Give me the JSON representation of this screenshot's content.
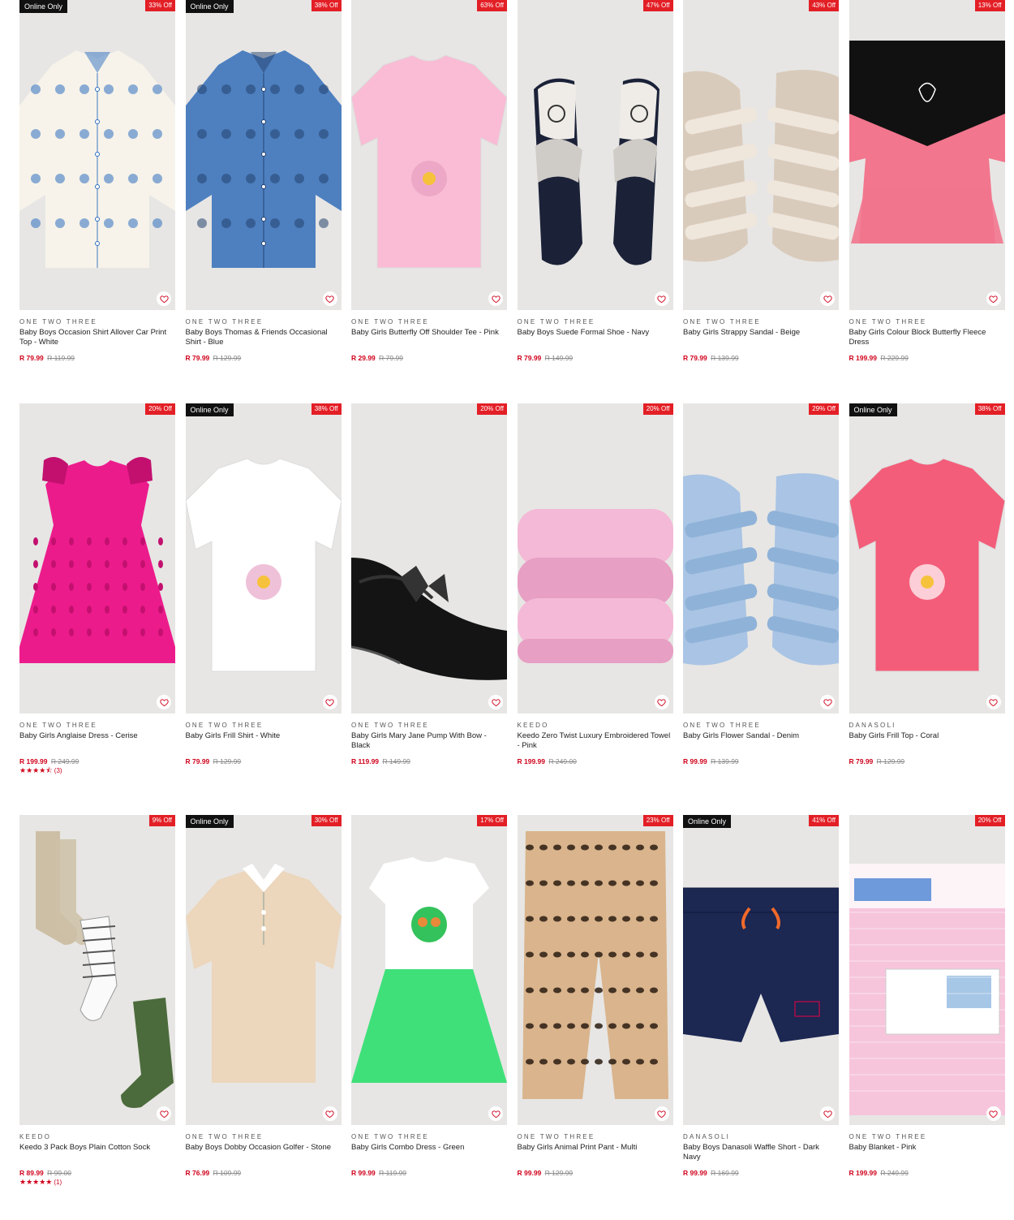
{
  "products": [
    {
      "brand": "ONE TWO THREE",
      "name": "Baby Boys Occasion Shirt Allover Car Print Top - White",
      "price": "R 79.99",
      "was": "R 119.99",
      "discount": "33% Off",
      "online": "Online Only",
      "art": "shirt",
      "color": "#f7f3ea",
      "accent": "#2f6fc0"
    },
    {
      "brand": "ONE TWO THREE",
      "name": "Baby Boys Thomas & Friends Occasional Shirt - Blue",
      "price": "R 79.99",
      "was": "R 129.99",
      "discount": "38% Off",
      "online": "Online Only",
      "art": "shirt",
      "color": "#4e80c0",
      "accent": "#24416e"
    },
    {
      "brand": "ONE TWO THREE",
      "name": "Baby Girls Butterfly Off Shoulder Tee - Pink",
      "price": "R 29.99",
      "was": "R 79.99",
      "discount": "63% Off",
      "online": "",
      "art": "tee",
      "color": "#f9bcd4",
      "accent": "#e7a0c0"
    },
    {
      "brand": "ONE TWO THREE",
      "name": "Baby Boys Suede Formal Shoe - Navy",
      "price": "R 79.99",
      "was": "R 149.99",
      "discount": "47% Off",
      "online": "",
      "art": "shoes",
      "color": "#1b2238",
      "accent": "#cfcbc6"
    },
    {
      "brand": "ONE TWO THREE",
      "name": "Baby Girls Strappy Sandal - Beige",
      "price": "R 79.99",
      "was": "R 139.99",
      "discount": "43% Off",
      "online": "",
      "art": "sandal",
      "color": "#efe6dc",
      "accent": "#d9cbbb"
    },
    {
      "brand": "ONE TWO THREE",
      "name": "Baby Girls Colour Block Butterfly Fleece Dress",
      "price": "R 199.99",
      "was": "R 229.99",
      "discount": "13% Off",
      "online": "",
      "art": "dressblock",
      "color": "#f2768e",
      "accent": "#111111"
    },
    {
      "brand": "ONE TWO THREE",
      "name": "Baby Girls Anglaise Dress - Cerise",
      "price": "R 199.99",
      "was": "R 249.99",
      "discount": "20% Off",
      "online": "",
      "art": "dress",
      "color": "#ec1b8c",
      "accent": "#c3106f",
      "stars": "★★★★⯪",
      "rating_count": "(3)"
    },
    {
      "brand": "ONE TWO THREE",
      "name": "Baby Girls Frill Shirt - White",
      "price": "R 79.99",
      "was": "R 129.99",
      "discount": "38% Off",
      "online": "Online Only",
      "art": "tee",
      "color": "#ffffff",
      "accent": "#e8a6c8"
    },
    {
      "brand": "ONE TWO THREE",
      "name": "Baby Girls Mary Jane Pump With Bow - Black",
      "price": "R 119.99",
      "was": "R 149.99",
      "discount": "20% Off",
      "online": "",
      "art": "pump",
      "color": "#141414",
      "accent": "#333333"
    },
    {
      "brand": "KEEDO",
      "name": "Keedo Zero Twist Luxury Embroidered Towel - Pink",
      "price": "R 199.99",
      "was": "R 249.00",
      "discount": "20% Off",
      "online": "",
      "art": "towel",
      "color": "#f4b9d6",
      "accent": "#e79fc4"
    },
    {
      "brand": "ONE TWO THREE",
      "name": "Baby Girls Flower Sandal - Denim",
      "price": "R 99.99",
      "was": "R 139.99",
      "discount": "29% Off",
      "online": "",
      "art": "sandal",
      "color": "#8fb2d8",
      "accent": "#a9c4e4"
    },
    {
      "brand": "DANASOLI",
      "name": "Baby Girls Frill Top - Coral",
      "price": "R 79.99",
      "was": "R 129.99",
      "discount": "38% Off",
      "online": "Online Only",
      "art": "tee",
      "color": "#f35d79",
      "accent": "#ffffff"
    },
    {
      "brand": "KEEDO",
      "name": "Keedo 3 Pack Boys Plain Cotton Sock",
      "price": "R 89.99",
      "was": "R 99.00",
      "discount": "9% Off",
      "online": "",
      "art": "socks",
      "color": "#cdbfa6",
      "accent": "#4c6b3c",
      "stars": "★★★★★",
      "rating_count": "(1)"
    },
    {
      "brand": "ONE TWO THREE",
      "name": "Baby Boys Dobby Occasion Golfer - Stone",
      "price": "R 76.99",
      "was": "R 109.99",
      "discount": "30% Off",
      "online": "Online Only",
      "art": "polo",
      "color": "#ecd6bc",
      "accent": "#ffffff"
    },
    {
      "brand": "ONE TWO THREE",
      "name": "Baby Girls Combo Dress - Green",
      "price": "R 99.99",
      "was": "R 119.99",
      "discount": "17% Off",
      "online": "",
      "art": "combo",
      "color": "#3fe07a",
      "accent": "#ffffff"
    },
    {
      "brand": "ONE TWO THREE",
      "name": "Baby Girls Animal Print Pant - Multi",
      "price": "R 99.99",
      "was": "R 129.99",
      "discount": "23% Off",
      "online": "",
      "art": "pants",
      "color": "#d9b48c",
      "accent": "#2a1c12"
    },
    {
      "brand": "DANASOLI",
      "name": "Baby Boys Danasoli Waffle Short - Dark Navy",
      "price": "R 99.99",
      "was": "R 169.99",
      "discount": "41% Off",
      "online": "Online Only",
      "art": "shorts",
      "color": "#1c2752",
      "accent": "#f06a2a"
    },
    {
      "brand": "ONE TWO THREE",
      "name": "Baby Blanket - Pink",
      "price": "R 199.99",
      "was": "R 249.99",
      "discount": "20% Off",
      "online": "",
      "art": "blanket",
      "color": "#f6c5dc",
      "accent": "#5e8fd6"
    }
  ],
  "icons": {
    "wishlist": "heart-outline-icon",
    "rating": "star-icon"
  },
  "colors": {
    "sale_red": "#e31f26",
    "badge_black": "#111111",
    "image_bg": "#e7e6e4"
  }
}
